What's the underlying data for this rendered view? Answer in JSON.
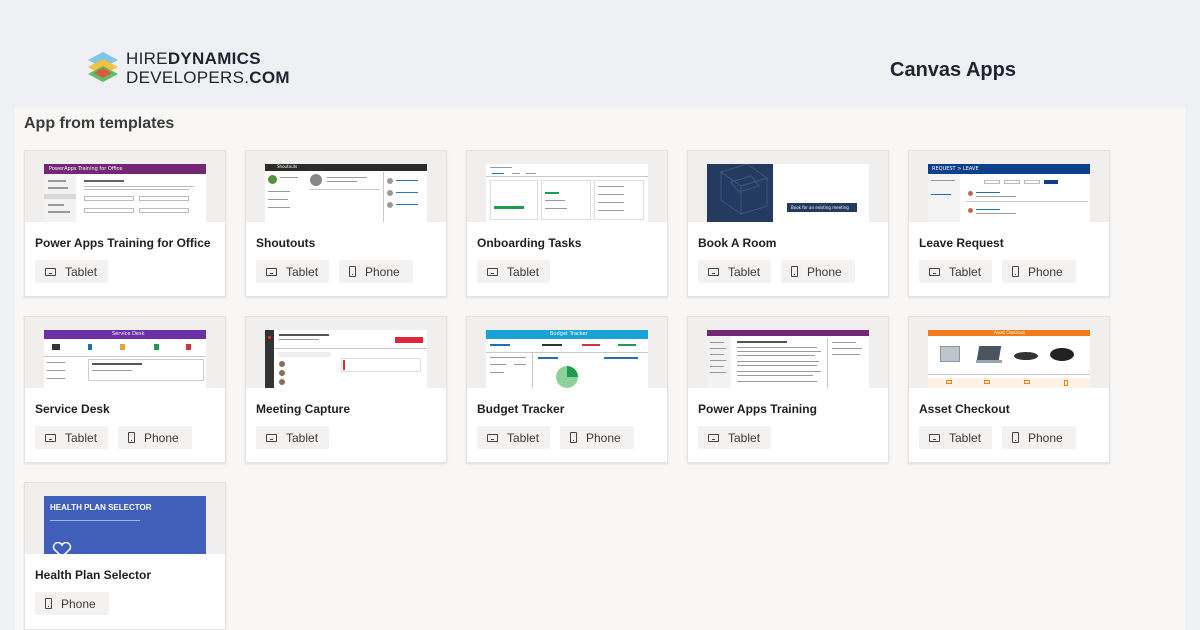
{
  "header": {
    "logo_line1_regular": "HIRE",
    "logo_line1_bold": "DYNAMICS",
    "logo_line2_regular": "DEVELOPERS.",
    "logo_line2_bold": "COM",
    "page_title": "Canvas Apps"
  },
  "section": {
    "title": "App from templates"
  },
  "labels": {
    "tablet": "Tablet",
    "phone": "Phone"
  },
  "templates": [
    {
      "name": "Power Apps Training for Office",
      "form_factors": [
        "Tablet"
      ],
      "thumb_text": "PowerApps Training for Office",
      "accent": "#742774"
    },
    {
      "name": "Shoutouts",
      "form_factors": [
        "Tablet",
        "Phone"
      ],
      "thumb_text": "Shoutouts",
      "accent": "#2b2b2b"
    },
    {
      "name": "Onboarding Tasks",
      "form_factors": [
        "Tablet"
      ],
      "thumb_text": "",
      "accent": "#1e9b4c"
    },
    {
      "name": "Book A Room",
      "form_factors": [
        "Tablet",
        "Phone"
      ],
      "thumb_text": "Book for an existing meeting",
      "accent": "#243a5e"
    },
    {
      "name": "Leave Request",
      "form_factors": [
        "Tablet",
        "Phone"
      ],
      "thumb_text": "REQUEST > LEAVE",
      "accent": "#0e3f8a"
    },
    {
      "name": "Service Desk",
      "form_factors": [
        "Tablet",
        "Phone"
      ],
      "thumb_text": "Service Desk",
      "accent": "#6b2fa8"
    },
    {
      "name": "Meeting Capture",
      "form_factors": [
        "Tablet"
      ],
      "thumb_text": "",
      "accent": "#e0263c"
    },
    {
      "name": "Budget Tracker",
      "form_factors": [
        "Tablet",
        "Phone"
      ],
      "thumb_text": "Budget Tracker",
      "accent": "#19a3d9"
    },
    {
      "name": "Power Apps Training",
      "form_factors": [
        "Tablet"
      ],
      "thumb_text": "",
      "accent": "#742774"
    },
    {
      "name": "Asset Checkout",
      "form_factors": [
        "Tablet",
        "Phone"
      ],
      "thumb_text": "Asset Checkout",
      "accent": "#f07c1a"
    },
    {
      "name": "Health Plan Selector",
      "form_factors": [
        "Phone"
      ],
      "thumb_text": "HEALTH PLAN SELECTOR",
      "accent": "#3f5fba"
    }
  ]
}
